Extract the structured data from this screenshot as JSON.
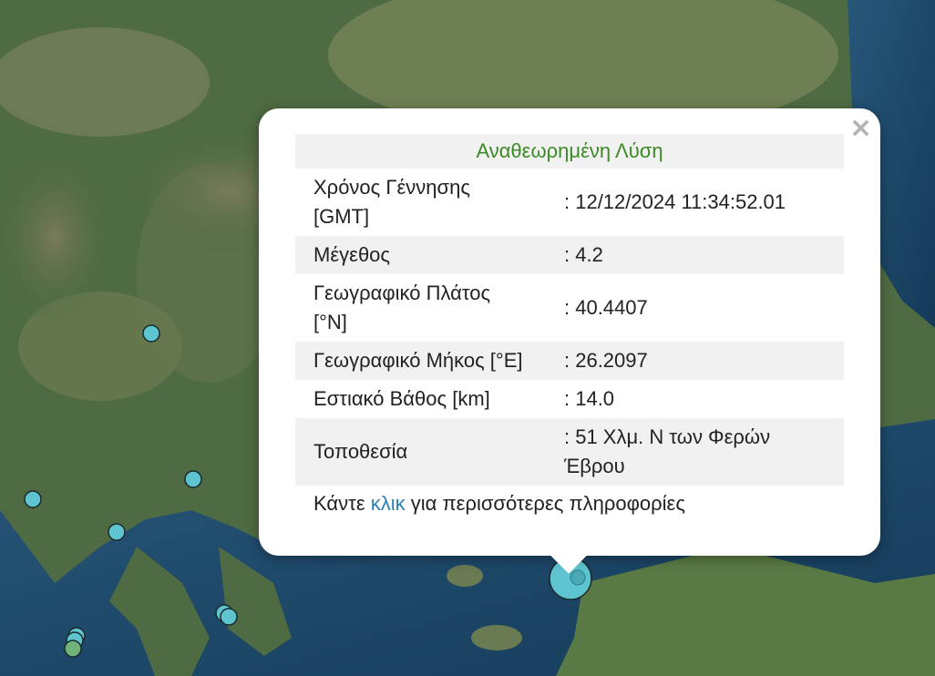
{
  "popup": {
    "title": "Αναθεωρημένη Λύση",
    "close": "×",
    "rows": [
      {
        "label": "Χρόνος Γέννησης [GMT]",
        "value": ": 12/12/2024 11:34:52.01"
      },
      {
        "label": "Μέγεθος",
        "value": ": 4.2"
      },
      {
        "label": "Γεωγραφικό Πλάτος [°N]",
        "value": ": 40.4407"
      },
      {
        "label": "Γεωγραφικό Μήκος [°E]",
        "value": ": 26.2097"
      },
      {
        "label": "Εστιακό Βάθος [km]",
        "value": ": 14.0"
      },
      {
        "label": "Τοποθεσία",
        "value": ": 51 Χλμ. Ν των Φερών Έβρου"
      }
    ],
    "more_prefix": "Κάντε ",
    "more_link": "κλικ",
    "more_suffix": " για περισσότερες πληροφορίες"
  },
  "colors": {
    "marker_cyan": "#5ec4d0",
    "marker_green": "#6fb27a",
    "title_green": "#3b8a25",
    "link_blue": "#2f7fb3",
    "sea": "#1f4a66",
    "land": "#4d6a42"
  }
}
